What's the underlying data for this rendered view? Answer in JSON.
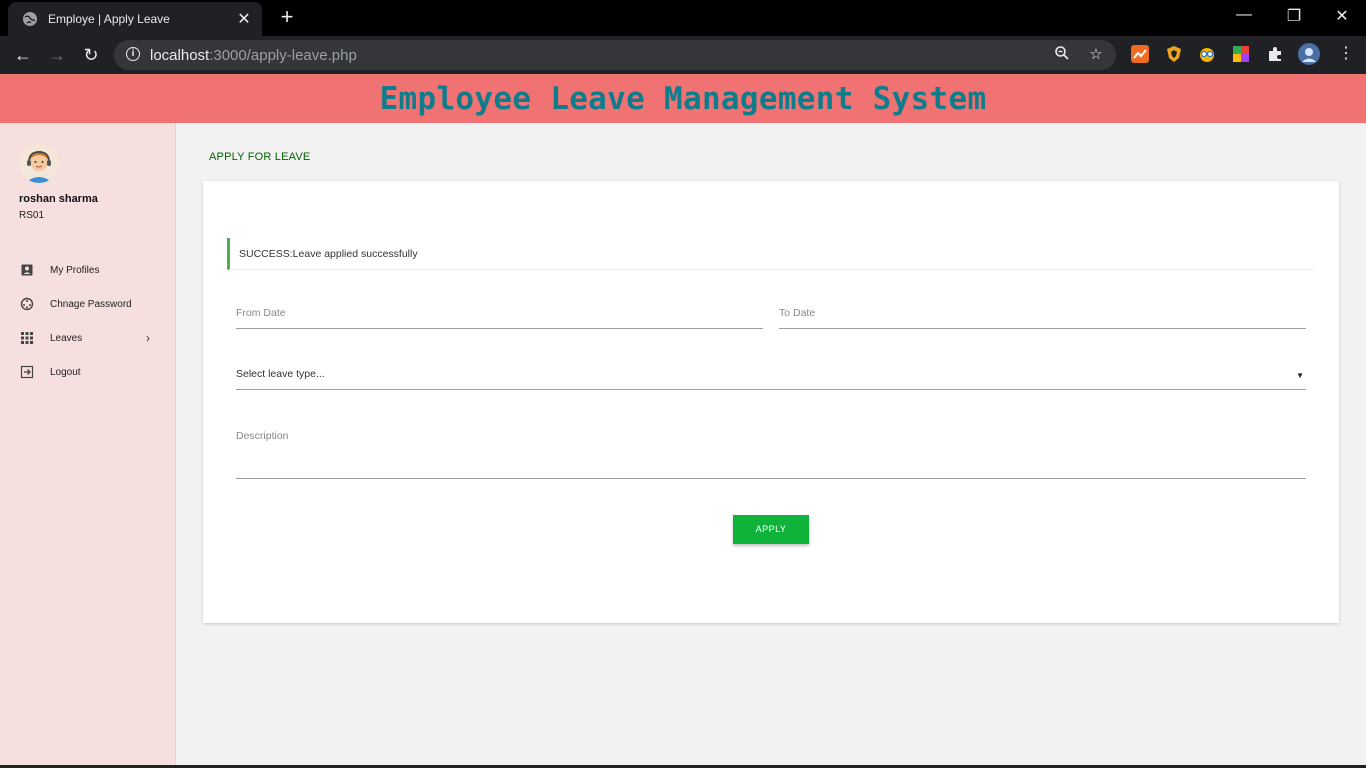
{
  "browser": {
    "tab_title": "Employe | Apply Leave",
    "url_host": "localhost",
    "url_path": ":3000/apply-leave.php"
  },
  "header": {
    "title": "Employee Leave Management System",
    "background": "#f07273",
    "title_color": "#0f7c8c"
  },
  "sidebar": {
    "user_name": "roshan sharma",
    "user_code": "RS01",
    "items": [
      {
        "label": "My Profiles",
        "icon": "account-box-icon"
      },
      {
        "label": "Chnage Password",
        "icon": "settings-icon"
      },
      {
        "label": "Leaves",
        "icon": "apps-grid-icon",
        "has_submenu": true
      },
      {
        "label": "Logout",
        "icon": "exit-icon"
      }
    ]
  },
  "main": {
    "heading": "APPLY FOR LEAVE",
    "alert": "SUCCESS:Leave applied successfully",
    "alert_color": "#4caf50",
    "form": {
      "from_date_label": "From Date",
      "to_date_label": "To Date",
      "leave_type_selected": "Select leave type...",
      "description_label": "Description",
      "apply_label": "APPLY"
    },
    "button_color": "#0fb33a"
  }
}
